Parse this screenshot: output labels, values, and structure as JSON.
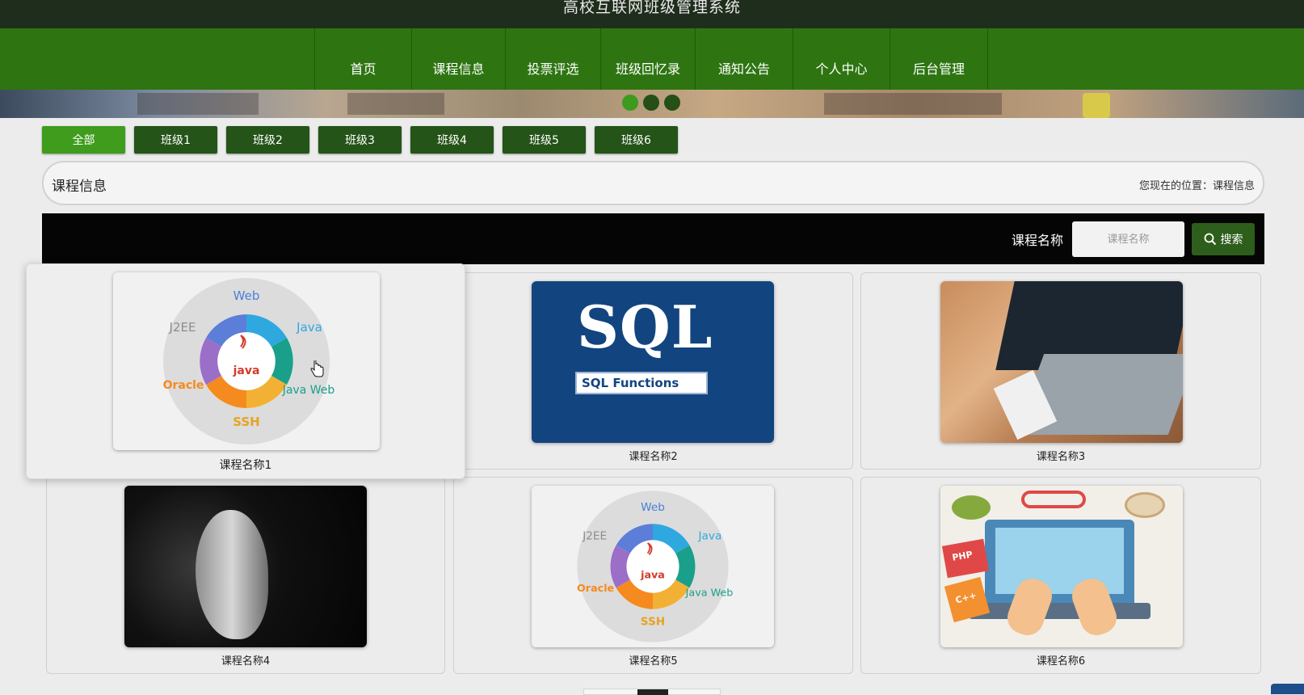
{
  "app": {
    "title": "高校互联网班级管理系统"
  },
  "nav": {
    "items": [
      {
        "label": "首页"
      },
      {
        "label": "课程信息"
      },
      {
        "label": "投票评选"
      },
      {
        "label": "班级回忆录"
      },
      {
        "label": "通知公告"
      },
      {
        "label": "个人中心"
      },
      {
        "label": "后台管理"
      }
    ]
  },
  "banner": {
    "slides": 3,
    "active_slide": 1
  },
  "class_tabs": [
    {
      "label": "全部",
      "active": true
    },
    {
      "label": "班级1"
    },
    {
      "label": "班级2"
    },
    {
      "label": "班级3"
    },
    {
      "label": "班级4"
    },
    {
      "label": "班级5"
    },
    {
      "label": "班级6"
    }
  ],
  "breadcrumb": {
    "page_title": "课程信息",
    "location": "您现在的位置：课程信息"
  },
  "search": {
    "label": "课程名称",
    "placeholder": "课程名称",
    "value": "",
    "button_label": "搜索"
  },
  "courses": [
    {
      "name": "课程名称1",
      "image": "java-roadmap"
    },
    {
      "name": "课程名称2",
      "image": "sql-functions"
    },
    {
      "name": "课程名称3",
      "image": "laptop-desk"
    },
    {
      "name": "课程名称4",
      "image": "ai-head"
    },
    {
      "name": "课程名称5",
      "image": "java-roadmap"
    },
    {
      "name": "课程名称6",
      "image": "php-laptop"
    }
  ],
  "java_diagram": {
    "segments": [
      "Web",
      "Java",
      "Java Web",
      "SSH",
      "Oracle",
      "J2EE"
    ],
    "center": "java"
  },
  "sql_image": {
    "title": "SQL",
    "subtitle": "SQL Functions"
  },
  "php_image": {
    "book1": "PHP",
    "book2": "C++"
  },
  "colors": {
    "nav": "#2e7512",
    "topbar": "#1f2e1c",
    "tab_active": "#3f9c1c",
    "tab": "#245418"
  }
}
